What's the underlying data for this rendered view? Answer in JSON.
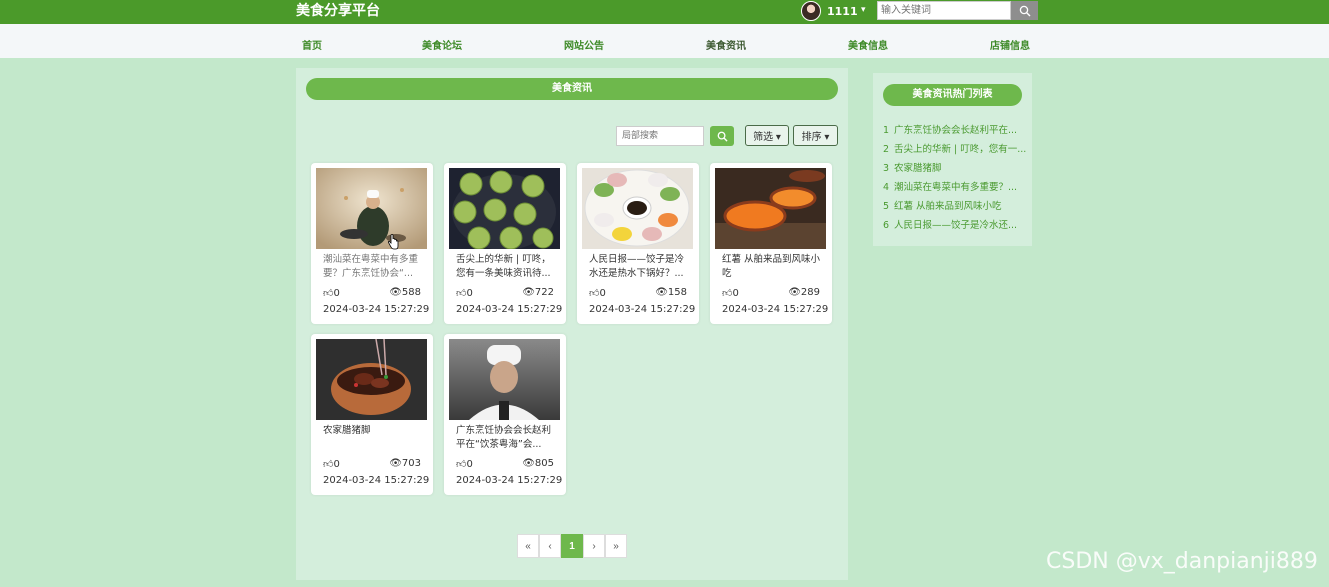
{
  "header": {
    "brand": "美食分享平台",
    "username": "1111",
    "caret": "▾",
    "search_placeholder": "输入关键词"
  },
  "nav": {
    "items": [
      "首页",
      "美食论坛",
      "网站公告",
      "美食资讯",
      "美食信息",
      "店铺信息"
    ],
    "active_index": 3
  },
  "main": {
    "title": "美食资讯",
    "search_placeholder": "局部搜索",
    "filter_label": "筛选 ▾",
    "sort_label": "排序 ▾",
    "cards": [
      {
        "title": "潮汕菜在粤菜中有多重要？广东烹饪协会“...",
        "likes": "0",
        "views": "588",
        "date": "2024-03-24 15:27:29",
        "image": "chef-wok-image"
      },
      {
        "title": "舌尖上的华新 | 叮咚，您有一条美味资讯待...",
        "likes": "0",
        "views": "722",
        "date": "2024-03-24 15:27:29",
        "image": "pancakes-pan-image"
      },
      {
        "title": "人民日报——饺子是冷水还是热水下锅好？...",
        "likes": "0",
        "views": "158",
        "date": "2024-03-24 15:27:29",
        "image": "dumplings-plate-image"
      },
      {
        "title": "红薯 从舶来品到风味小吃",
        "likes": "0",
        "views": "289",
        "date": "2024-03-24 15:27:29",
        "image": "sweet-potato-image"
      },
      {
        "title": "农家腊猪脚",
        "likes": "0",
        "views": "703",
        "date": "2024-03-24 15:27:29",
        "image": "pork-pot-image"
      },
      {
        "title": "广东烹饪协会会长赵利平在“饮茶粤海”会...",
        "likes": "0",
        "views": "805",
        "date": "2024-03-24 15:27:29",
        "image": "chef-portrait-image"
      }
    ],
    "pagination": {
      "first": "«",
      "prev": "‹",
      "current": "1",
      "next": "›",
      "last": "»"
    }
  },
  "sidebar": {
    "title": "美食资讯热门列表",
    "items": [
      {
        "num": "1",
        "text": "广东烹饪协会会长赵利平在..."
      },
      {
        "num": "2",
        "text": "舌尖上的华新 | 叮咚，您有一..."
      },
      {
        "num": "3",
        "text": "农家腊猪脚"
      },
      {
        "num": "4",
        "text": "潮汕菜在粤菜中有多重要？..."
      },
      {
        "num": "5",
        "text": "红薯 从舶来品到风味小吃"
      },
      {
        "num": "6",
        "text": "人民日报——饺子是冷水还..."
      }
    ]
  },
  "watermark": "CSDN @vx_danpianji889",
  "colors": {
    "topbar": "#4b9a2a",
    "accent": "#6eb84c",
    "page_bg": "#c3e8cb",
    "panel_bg": "#d4eedc"
  }
}
